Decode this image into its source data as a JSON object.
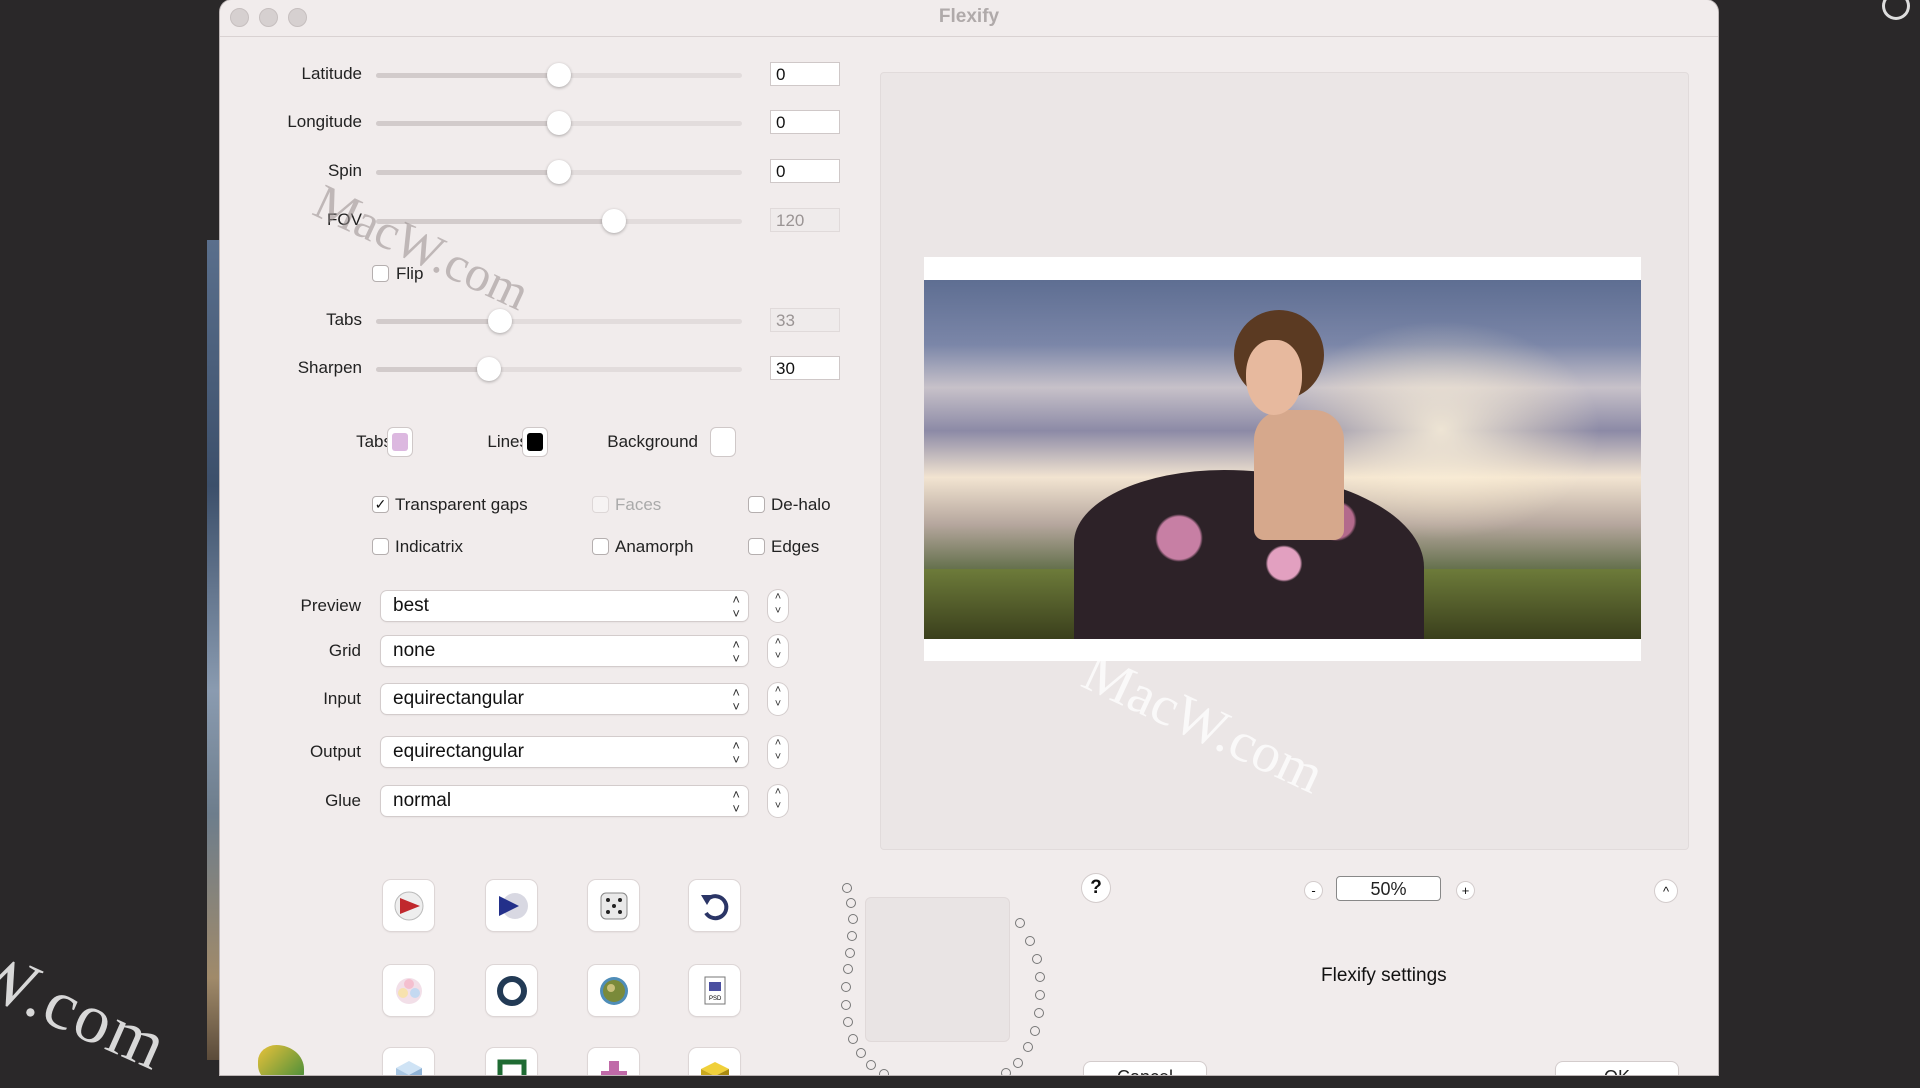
{
  "window": {
    "title": "Flexify"
  },
  "sliders": [
    {
      "label": "Latitude",
      "value": "0",
      "disabled": false,
      "level": 0.5
    },
    {
      "label": "Longitude",
      "value": "0",
      "disabled": false,
      "level": 0.5
    },
    {
      "label": "Spin",
      "value": "0",
      "disabled": false,
      "level": 0.5
    },
    {
      "label": "FOV",
      "value": "120",
      "disabled": true,
      "level": 0.65
    },
    {
      "label": "Tabs",
      "value": "33",
      "disabled": true,
      "level": 0.34
    },
    {
      "label": "Sharpen",
      "value": "30",
      "disabled": false,
      "level": 0.31
    }
  ],
  "flip": {
    "label": "Flip",
    "checked": false
  },
  "colors": {
    "tabs_label": "Tabs",
    "tabs_color": "#dcb8e0",
    "lines_label": "Lines",
    "lines_color": "#000000",
    "background_label": "Background",
    "background_color": "#ffffff"
  },
  "options": [
    {
      "label": "Transparent gaps",
      "checked": true,
      "disabled": false
    },
    {
      "label": "Faces",
      "checked": false,
      "disabled": true
    },
    {
      "label": "De-halo",
      "checked": false,
      "disabled": false
    },
    {
      "label": "Indicatrix",
      "checked": false,
      "disabled": false
    },
    {
      "label": "Anamorph",
      "checked": false,
      "disabled": false
    },
    {
      "label": "Edges",
      "checked": false,
      "disabled": false
    }
  ],
  "dropdowns": [
    {
      "label": "Preview",
      "value": "best"
    },
    {
      "label": "Grid",
      "value": "none"
    },
    {
      "label": "Input",
      "value": "equirectangular"
    },
    {
      "label": "Output",
      "value": "equirectangular"
    },
    {
      "label": "Glue",
      "value": "normal"
    }
  ],
  "tool_icons": [
    "red-play-arrow-icon",
    "blue-play-disc-icon",
    "dice-icon",
    "undo-arrow-icon",
    "color-wheel-icon",
    "ring-icon",
    "globe-planet-icon",
    "psd-file-icon",
    "cube-icon",
    "green-frame-icon",
    "pink-puzzle-icon",
    "yellow-brick-icon"
  ],
  "help": {
    "label": "?"
  },
  "zoom": {
    "minus": "-",
    "value": "50%",
    "plus": "+"
  },
  "collapse": {
    "label": "^"
  },
  "settings_label": "Flexify settings",
  "buttons": {
    "cancel": "Cancel",
    "ok": "OK"
  },
  "watermark": "MacW.com",
  "bg_watermark": "W.com"
}
